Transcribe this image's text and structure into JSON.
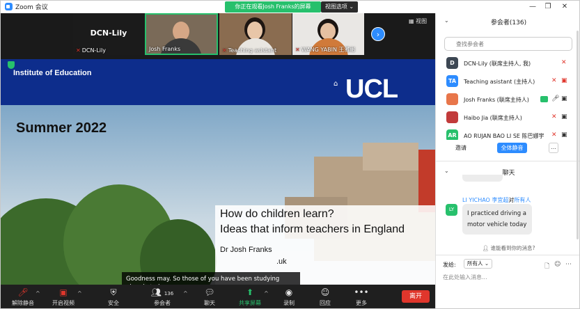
{
  "window": {
    "title": "Zoom 会议",
    "viewing_banner": "你正在观看Josh Franks的屏幕",
    "view_options": "视图选项 ⌄"
  },
  "thumbs": {
    "items": [
      {
        "label": "DCN-Lily",
        "big": "DCN-Lily"
      },
      {
        "label": "Josh Franks"
      },
      {
        "label": "Teaching asistant"
      },
      {
        "label": "WANG YABIN 王雅彬"
      }
    ],
    "view_label": "视图"
  },
  "share": {
    "institute": "Institute of Education",
    "logo": "UCL",
    "summer": "Summer 2022",
    "line1": "How do children learn?",
    "line2": "Ideas that inform teachers in England",
    "name": "Dr Josh Franks",
    "email_fragment": ".uk",
    "caption": "Goodness may. So those of you have been studying already today."
  },
  "toolbar": {
    "unmute": "解除静音",
    "video": "开启视频",
    "security": "安全",
    "participants": "参会者",
    "participants_count": "136",
    "chat": "聊天",
    "share": "共享屏幕",
    "record": "录制",
    "reactions": "回应",
    "more": "更多",
    "leave": "离开"
  },
  "side": {
    "participants_title": "参会者(136)",
    "search_placeholder": "查找参会者",
    "participants": [
      {
        "avatar": "D",
        "color": "#3d4753",
        "name": "DCN-Lily (联席主持人, 我)"
      },
      {
        "avatar": "TA",
        "color": "#2d8cff",
        "name": "Teaching asistant (主持人)"
      },
      {
        "avatar": "",
        "color": "#e8764a",
        "name": "Josh Franks (联席主持人)"
      },
      {
        "avatar": "",
        "color": "#c23b3b",
        "name": "Haibo Jia (联席主持人)"
      },
      {
        "avatar": "AR",
        "color": "#27c06c",
        "name": "AO RUJAN BAO LI SE 陈巴娜宇"
      }
    ],
    "invite": "邀请",
    "mute_all": "全体静音",
    "more": "...",
    "chat_title": "聊天",
    "chat_sender": "LI YICHAO 李宜超",
    "chat_to": "对",
    "chat_recipient": "所有人",
    "chat_avatar": "LY",
    "chat_message": "I practiced driving a motor vehicle today",
    "who_sees": "谁能看到你的消息?",
    "send_to_label": "发给:",
    "send_to_value": "所有人 ⌄",
    "input_placeholder": "在此处输入消息..."
  }
}
